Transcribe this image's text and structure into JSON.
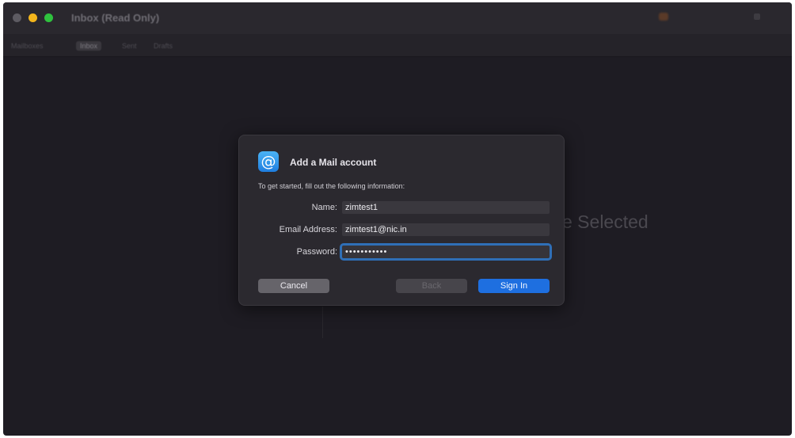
{
  "window": {
    "title": "Inbox (Read Only)"
  },
  "mailbox_tabs": [
    {
      "label": "Mailboxes"
    },
    {
      "label": "Inbox",
      "active": true
    },
    {
      "label": "Sent"
    },
    {
      "label": "Drafts"
    }
  ],
  "background": {
    "message_placeholder": "e Selected"
  },
  "dialog": {
    "icon": "at-sign-icon",
    "title": "Add a Mail account",
    "subtitle": "To get started, fill out the following information:",
    "fields": {
      "name": {
        "label": "Name:",
        "value": "zimtest1"
      },
      "email": {
        "label": "Email Address:",
        "value": "zimtest1@nic.in"
      },
      "password": {
        "label": "Password:",
        "value": "•••••••••••"
      }
    },
    "buttons": {
      "cancel": "Cancel",
      "back": "Back",
      "sign_in": "Sign In"
    }
  },
  "colors": {
    "accent": "#1e6fe0",
    "window_bg": "#1e1c23"
  }
}
